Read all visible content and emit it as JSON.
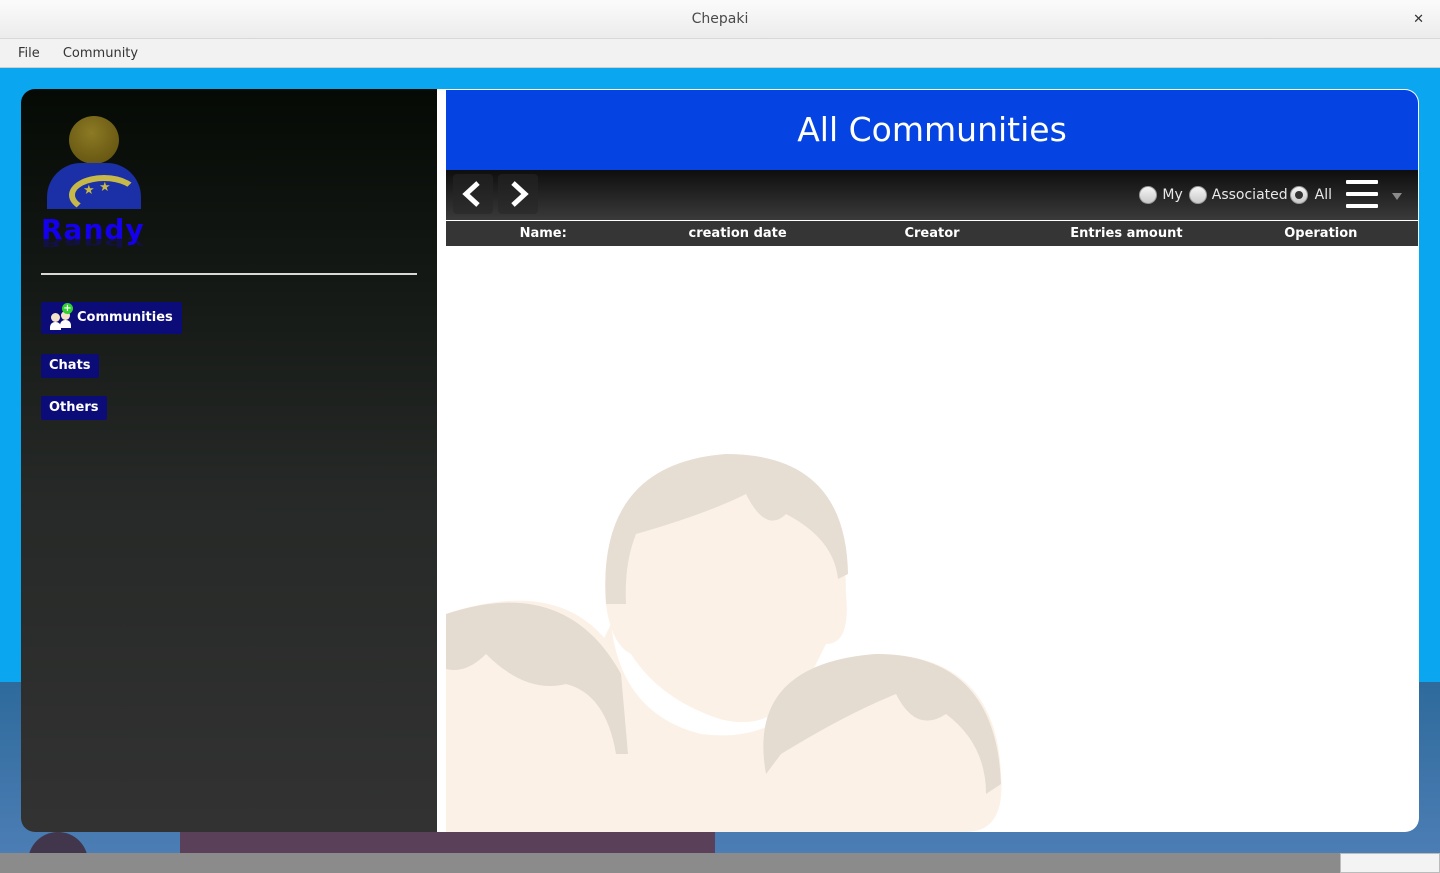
{
  "window": {
    "title": "Chepaki",
    "close_glyph": "✕"
  },
  "menubar": {
    "items": [
      "File",
      "Community"
    ]
  },
  "sidebar": {
    "username": "Randy",
    "nav": [
      {
        "label": "Communities",
        "icon": "community-add-icon"
      },
      {
        "label": "Chats"
      },
      {
        "label": "Others"
      }
    ]
  },
  "main": {
    "title": "All Communities",
    "filters": [
      {
        "label": "My",
        "checked": false
      },
      {
        "label": "Associated",
        "checked": false
      },
      {
        "label": "All",
        "checked": true
      }
    ],
    "table": {
      "columns": [
        "Name:",
        "creation date",
        "Creator",
        "Entries amount",
        "Operation"
      ],
      "rows": []
    }
  },
  "colors": {
    "header": "#0544e2",
    "nav_button": "#0c0c78",
    "username": "#1500ee",
    "desktop": "#0aa6f0"
  }
}
